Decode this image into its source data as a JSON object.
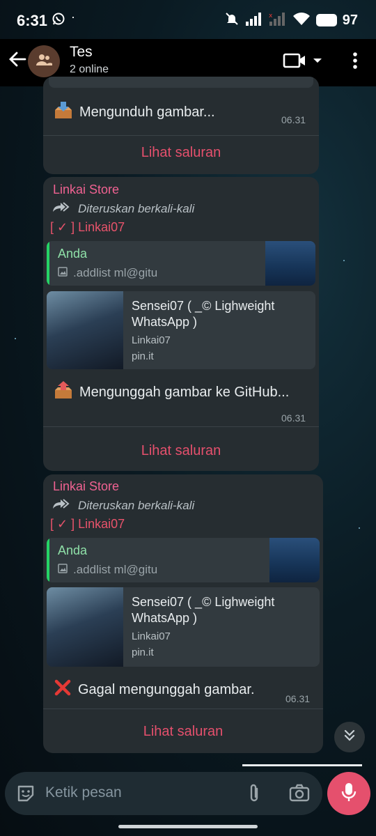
{
  "status_bar": {
    "time": "6:31",
    "dot": "·",
    "battery": "97"
  },
  "header": {
    "title": "Tes",
    "subtitle": "2 online"
  },
  "messages": [
    {
      "text": "Mengunduh gambar...",
      "time": "06.31",
      "action": "Lihat saluran"
    },
    {
      "sender": "Linkai Store",
      "forwarded": "Diteruskan berkali-kali",
      "tag": "[ ✓ ] Linkai07",
      "quote": {
        "name": "Anda",
        "text": ".addlist ml@gitu"
      },
      "link": {
        "title": " Sensei07 ( _© Lighweight WhatsApp )",
        "line1": "Linkai07",
        "line2": "pin.it"
      },
      "text": "Mengunggah gambar ke GitHub...",
      "time": "06.31",
      "action": "Lihat saluran"
    },
    {
      "sender": "Linkai Store",
      "forwarded": "Diteruskan berkali-kali",
      "tag": "[ ✓ ] Linkai07",
      "quote": {
        "name": "Anda",
        "text": ".addlist ml@gitu"
      },
      "link": {
        "title": " Sensei07 ( _© Lighweight WhatsApp )",
        "line1": "Linkai07",
        "line2": "pin.it"
      },
      "text": "Gagal mengunggah gambar.",
      "time": "06.31",
      "action": "Lihat saluran"
    }
  ],
  "composer": {
    "placeholder": "Ketik pesan"
  },
  "colors": {
    "accent": "#e5506d",
    "sender": "#f06292",
    "quote_bar": "#25d366",
    "bubble": "#262d31"
  },
  "icons": {
    "download": "inbox-tray-icon",
    "upload": "outbox-tray-icon",
    "fail": "cross-mark-icon"
  }
}
